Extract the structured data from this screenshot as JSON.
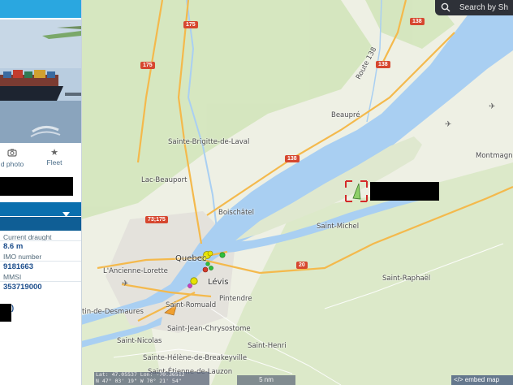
{
  "search": {
    "placeholder": "Search by Sh",
    "icon": "search-icon"
  },
  "sidebar": {
    "actions": [
      {
        "label": "d photo",
        "icon": "camera-icon"
      },
      {
        "label": "Fleet",
        "icon": "star-icon"
      }
    ],
    "fields": [
      {
        "label": "Current draught",
        "value": "8.6 m"
      },
      {
        "label": "IMO number",
        "value": "9181663"
      },
      {
        "label": "MMSI",
        "value": "353719000"
      }
    ],
    "dropdown_icon": "chevron-down-icon",
    "partial_text": ")"
  },
  "map": {
    "places": [
      "Sainte-Brigitte-de-Laval",
      "Lac-Beauport",
      "Beaupré",
      "Boischâtel",
      "Saint-Michel",
      "Montmagn",
      "Quebec",
      "L'Ancienne-Lorette",
      "Lévis",
      "Pintendre",
      "Saint-Raphaël",
      "Saint-Romuald",
      "tin-de-Desmaures",
      "Saint-Jean-Chrysostome",
      "Saint-Nicolas",
      "Saint-Henri",
      "Sainte-Hélène-de-Breakeyville",
      "Saint-Étienne-de-Lauzon",
      "Route 138"
    ],
    "highways": [
      "175",
      "175",
      "138",
      "138",
      "138",
      "73;175",
      "20"
    ]
  },
  "footer": {
    "coords_line1": "Lat: 47.05537 Lon: -70.36512",
    "coords_line2": "N 47° 03' 19\" W 70° 21' 54\"",
    "scale": "5 nm",
    "embed": "</> embed map"
  },
  "colors": {
    "water": "#a9cff2",
    "land": "#eef0e4",
    "forest": "#cfe3b6",
    "accent": "#2aa7e0",
    "dark_blue": "#0a6fae"
  }
}
